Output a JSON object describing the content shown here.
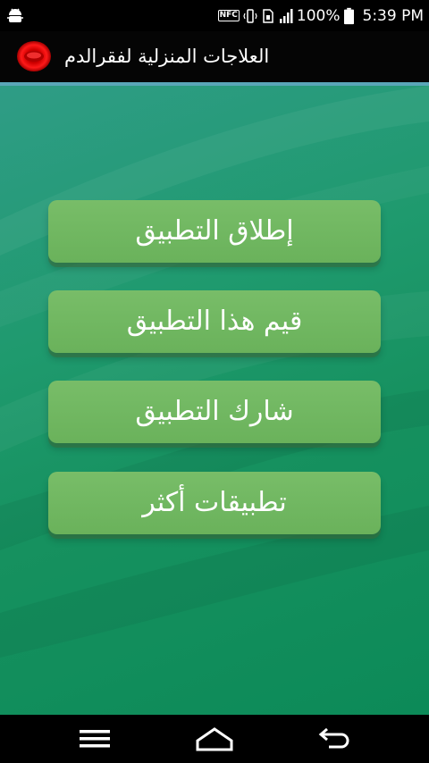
{
  "status_bar": {
    "nfc_label": "NFC",
    "battery_percent": "100%",
    "time": "5:39 PM"
  },
  "app_bar": {
    "title": "العلاجات المنزلية لفقرالدم",
    "logo_icon": "red-blood-cell-icon"
  },
  "menu": {
    "items": [
      {
        "label": "إطلاق التطبيق"
      },
      {
        "label": "قيم هذا التطبيق"
      },
      {
        "label": "شارك التطبيق"
      },
      {
        "label": "تطبيقات أكثر"
      }
    ]
  },
  "nav_bar": {
    "icons": [
      "menu-icon",
      "home-icon",
      "back-icon"
    ]
  },
  "colors": {
    "background_top": "#2f9c86",
    "background_bottom": "#0c8a58",
    "button": "#6fb85f",
    "app_bar_underline": "#5aa6b8"
  }
}
